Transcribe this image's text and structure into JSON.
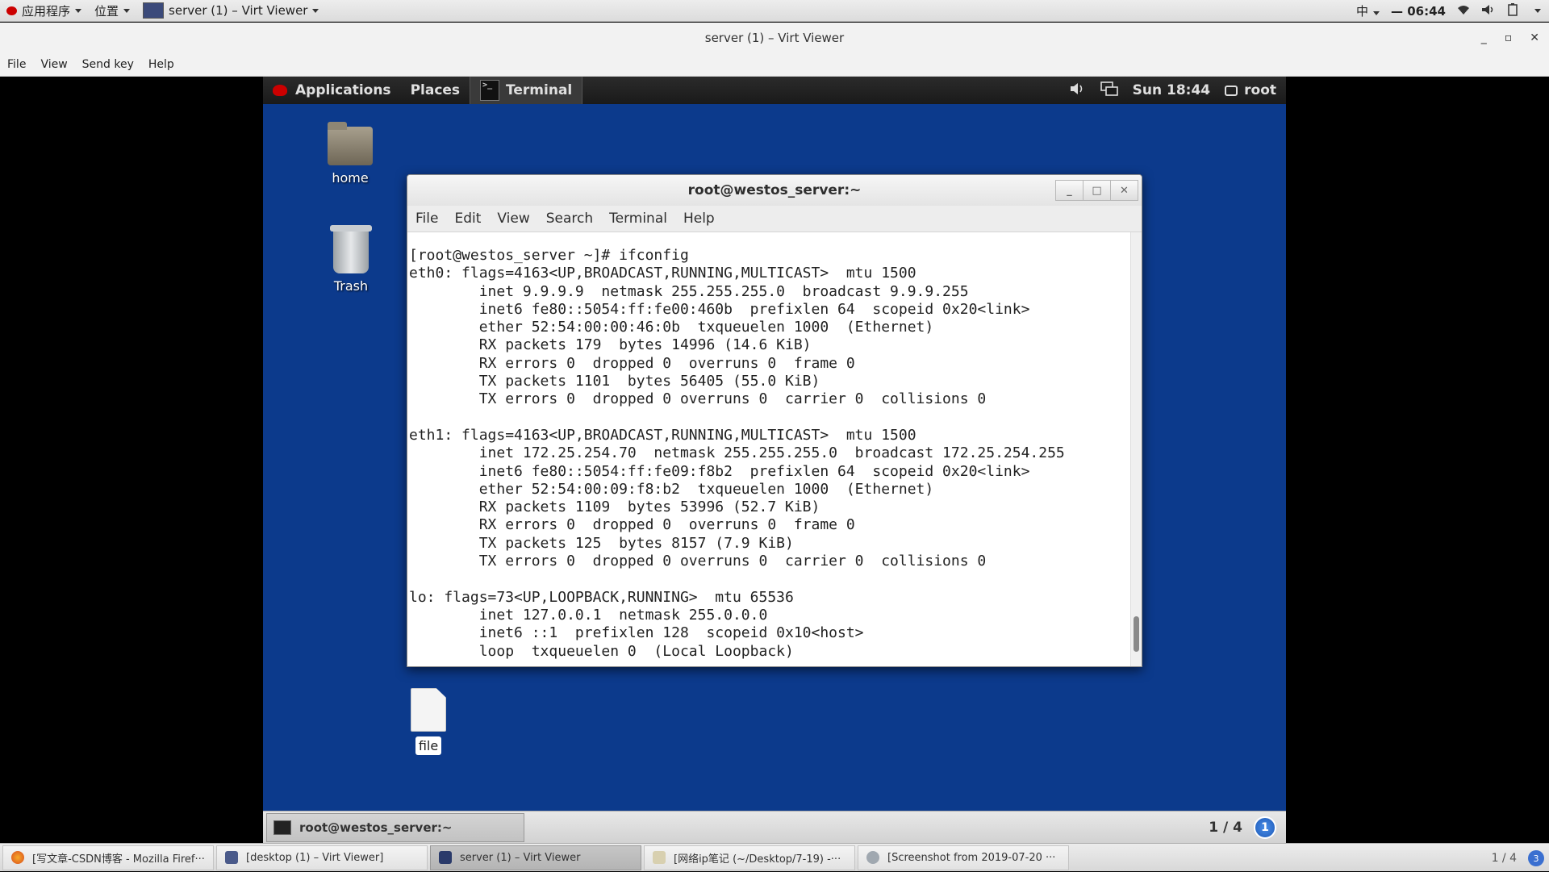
{
  "host_panel": {
    "apps_menu": "应用程序",
    "places_menu": "位置",
    "window_menu": "server (1) – Virt Viewer",
    "input_method": "中",
    "clock": "06:44"
  },
  "viewer": {
    "title": "server (1) – Virt Viewer",
    "menu": [
      "File",
      "View",
      "Send key",
      "Help"
    ]
  },
  "guest_panel": {
    "applications": "Applications",
    "places": "Places",
    "terminal_tab": "Terminal",
    "clock": "Sun 18:44",
    "user": "root"
  },
  "desktop_icons": {
    "home": "home",
    "trash": "Trash",
    "file": "file"
  },
  "terminal": {
    "title": "root@westos_server:~",
    "menu": [
      "File",
      "Edit",
      "View",
      "Search",
      "Terminal",
      "Help"
    ],
    "lines": [
      "[root@westos_server ~]# ifconfig",
      "eth0: flags=4163<UP,BROADCAST,RUNNING,MULTICAST>  mtu 1500",
      "        inet 9.9.9.9  netmask 255.255.255.0  broadcast 9.9.9.255",
      "        inet6 fe80::5054:ff:fe00:460b  prefixlen 64  scopeid 0x20<link>",
      "        ether 52:54:00:00:46:0b  txqueuelen 1000  (Ethernet)",
      "        RX packets 179  bytes 14996 (14.6 KiB)",
      "        RX errors 0  dropped 0  overruns 0  frame 0",
      "        TX packets 1101  bytes 56405 (55.0 KiB)",
      "        TX errors 0  dropped 0 overruns 0  carrier 0  collisions 0",
      "",
      "eth1: flags=4163<UP,BROADCAST,RUNNING,MULTICAST>  mtu 1500",
      "        inet 172.25.254.70  netmask 255.255.255.0  broadcast 172.25.254.255",
      "        inet6 fe80::5054:ff:fe09:f8b2  prefixlen 64  scopeid 0x20<link>",
      "        ether 52:54:00:09:f8:b2  txqueuelen 1000  (Ethernet)",
      "        RX packets 1109  bytes 53996 (52.7 KiB)",
      "        RX errors 0  dropped 0  overruns 0  frame 0",
      "        TX packets 125  bytes 8157 (7.9 KiB)",
      "        TX errors 0  dropped 0 overruns 0  carrier 0  collisions 0",
      "",
      "lo: flags=73<UP,LOOPBACK,RUNNING>  mtu 65536",
      "        inet 127.0.0.1  netmask 255.0.0.0",
      "        inet6 ::1  prefixlen 128  scopeid 0x10<host>",
      "        loop  txqueuelen 0  (Local Loopback)"
    ]
  },
  "guest_taskbar": {
    "task": "root@westos_server:~",
    "pager": "1 / 4",
    "badge": "1"
  },
  "host_taskbar": {
    "tasks": [
      "[写文章-CSDN博客 - Mozilla Firef···",
      "[desktop (1) – Virt Viewer]",
      "server (1) – Virt Viewer",
      "[网络ip笔记 (~/Desktop/7-19) -···",
      "[Screenshot from 2019-07-20 ···"
    ],
    "pager": "1 / 4",
    "badge": "3"
  }
}
